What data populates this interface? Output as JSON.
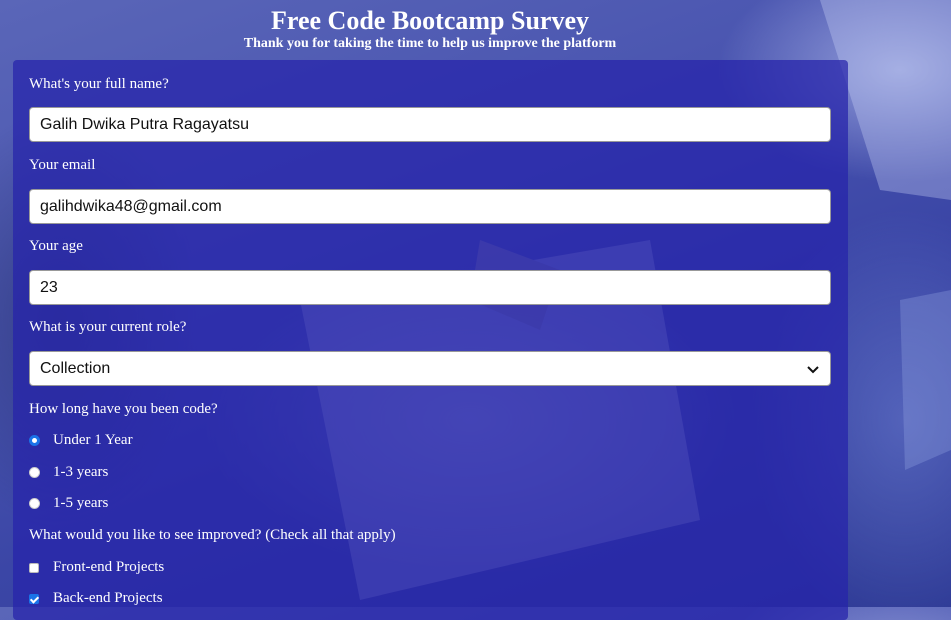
{
  "header": {
    "title": "Free Code Bootcamp Survey",
    "subtitle": "Thank you for taking the time to help us improve the platform"
  },
  "form": {
    "name_label": "What's your full name?",
    "name_value": "Galih Dwika Putra Ragayatsu",
    "email_label": "Your email",
    "email_value": "galihdwika48@gmail.com",
    "age_label": "Your age",
    "age_value": "23",
    "role_label": "What is your current role?",
    "role_selected": "Collection",
    "experience_label": "How long have you been code?",
    "experience_options": [
      {
        "label": "Under 1 Year",
        "checked": true
      },
      {
        "label": "1-3 years",
        "checked": false
      },
      {
        "label": "1-5 years",
        "checked": false
      }
    ],
    "improve_label": "What would you like to see improved? (Check all that apply)",
    "improve_options": [
      {
        "label": "Front-end Projects",
        "checked": false
      },
      {
        "label": "Back-end Projects",
        "checked": true
      }
    ]
  },
  "colors": {
    "card_bg": "#2622aa",
    "accent": "#1a73e8",
    "text": "#ffffff"
  }
}
